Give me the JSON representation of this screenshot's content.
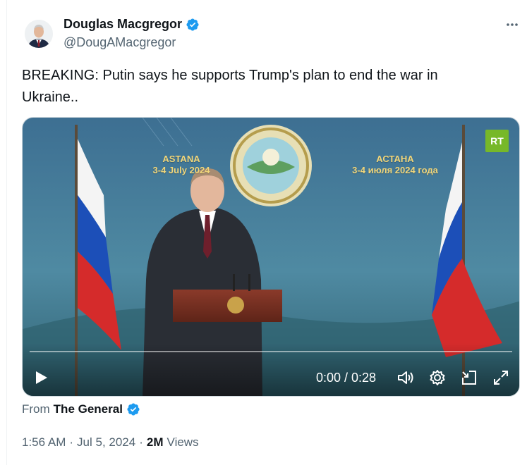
{
  "author": {
    "display_name": "Douglas Macgregor",
    "handle": "@DougAMacgregor",
    "verified_color": "#1d9bf0"
  },
  "tweet": {
    "text": "BREAKING: Putin says he supports Trump's plan to end the war in Ukraine.."
  },
  "video": {
    "banner_left_line1": "ASTANA",
    "banner_left_line2": "3-4 July 2024",
    "banner_right_line1": "АСТАНА",
    "banner_right_line2": "3-4 июля 2024 года",
    "logo": "RT",
    "time": "0:00 / 0:28",
    "progress": 0,
    "controls": [
      "play-icon",
      "volume-icon",
      "settings-gear-icon",
      "dock-icon",
      "fullscreen-icon"
    ]
  },
  "source": {
    "from_label": "From",
    "from_name": "The General"
  },
  "meta": {
    "time": "1:56 AM",
    "separator1": "·",
    "date": "Jul 5, 2024",
    "separator2": "·",
    "views_count": "2M",
    "views_label": "Views"
  },
  "colors": {
    "flag_white": "#f4f4f4",
    "flag_blue": "#1c4fb8",
    "flag_red": "#d52b2b",
    "rt_green": "#77b829",
    "backdrop": "#3f6f8f"
  }
}
